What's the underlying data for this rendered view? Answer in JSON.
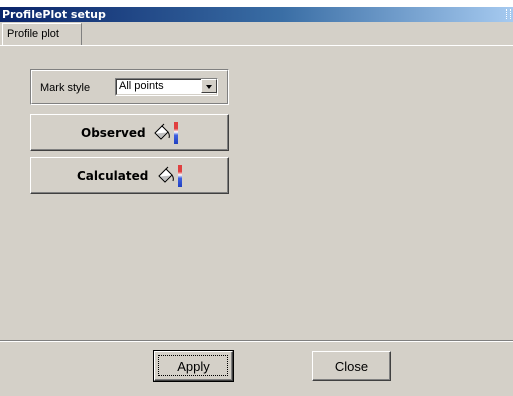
{
  "window": {
    "title": "ProfilePlot setup"
  },
  "tabs": [
    {
      "label": "Profile plot",
      "selected": true
    }
  ],
  "mark_style": {
    "label": "Mark style",
    "selected_value": "All points"
  },
  "series_buttons": {
    "observed_label": "Observed",
    "calculated_label": "Calculated",
    "icon": "paint-bucket-icon"
  },
  "footer": {
    "apply_label": "Apply",
    "close_label": "Close"
  },
  "colors": {
    "titlebar_start": "#0a246a",
    "titlebar_end": "#a6caf0",
    "face": "#d4d0c8"
  }
}
